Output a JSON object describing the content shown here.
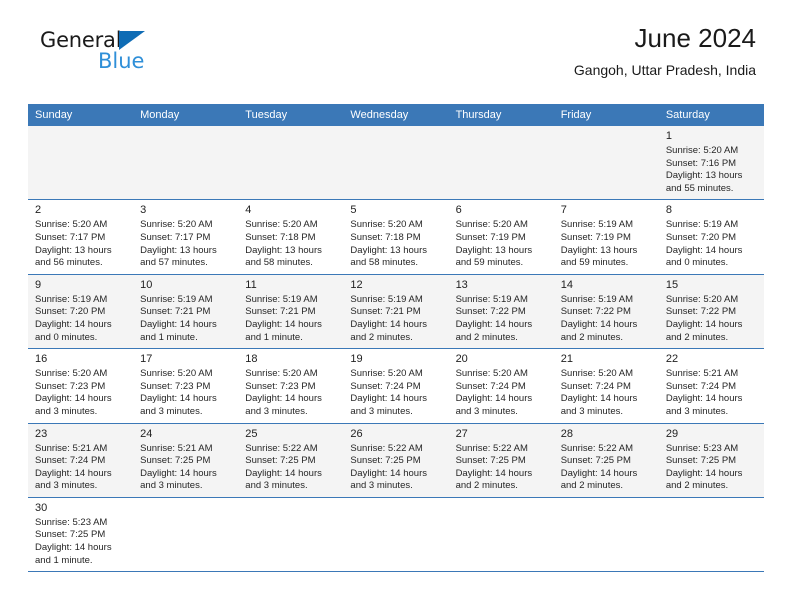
{
  "logo": {
    "word1": "General",
    "word2": "Blue",
    "triangle_color": "#0f6cb5",
    "word2_color": "#2f8fd8"
  },
  "header": {
    "title": "June 2024",
    "subtitle": "Gangoh, Uttar Pradesh, India"
  },
  "calendar": {
    "header_color": "#3b78b7",
    "weekdays": [
      "Sunday",
      "Monday",
      "Tuesday",
      "Wednesday",
      "Thursday",
      "Friday",
      "Saturday"
    ],
    "weeks": [
      [
        {
          "empty": true
        },
        {
          "empty": true
        },
        {
          "empty": true
        },
        {
          "empty": true
        },
        {
          "empty": true
        },
        {
          "empty": true
        },
        {
          "day": "1",
          "sunrise": "Sunrise: 5:20 AM",
          "sunset": "Sunset: 7:16 PM",
          "daylight1": "Daylight: 13 hours",
          "daylight2": "and 55 minutes."
        }
      ],
      [
        {
          "day": "2",
          "sunrise": "Sunrise: 5:20 AM",
          "sunset": "Sunset: 7:17 PM",
          "daylight1": "Daylight: 13 hours",
          "daylight2": "and 56 minutes."
        },
        {
          "day": "3",
          "sunrise": "Sunrise: 5:20 AM",
          "sunset": "Sunset: 7:17 PM",
          "daylight1": "Daylight: 13 hours",
          "daylight2": "and 57 minutes."
        },
        {
          "day": "4",
          "sunrise": "Sunrise: 5:20 AM",
          "sunset": "Sunset: 7:18 PM",
          "daylight1": "Daylight: 13 hours",
          "daylight2": "and 58 minutes."
        },
        {
          "day": "5",
          "sunrise": "Sunrise: 5:20 AM",
          "sunset": "Sunset: 7:18 PM",
          "daylight1": "Daylight: 13 hours",
          "daylight2": "and 58 minutes."
        },
        {
          "day": "6",
          "sunrise": "Sunrise: 5:20 AM",
          "sunset": "Sunset: 7:19 PM",
          "daylight1": "Daylight: 13 hours",
          "daylight2": "and 59 minutes."
        },
        {
          "day": "7",
          "sunrise": "Sunrise: 5:19 AM",
          "sunset": "Sunset: 7:19 PM",
          "daylight1": "Daylight: 13 hours",
          "daylight2": "and 59 minutes."
        },
        {
          "day": "8",
          "sunrise": "Sunrise: 5:19 AM",
          "sunset": "Sunset: 7:20 PM",
          "daylight1": "Daylight: 14 hours",
          "daylight2": "and 0 minutes."
        }
      ],
      [
        {
          "day": "9",
          "sunrise": "Sunrise: 5:19 AM",
          "sunset": "Sunset: 7:20 PM",
          "daylight1": "Daylight: 14 hours",
          "daylight2": "and 0 minutes."
        },
        {
          "day": "10",
          "sunrise": "Sunrise: 5:19 AM",
          "sunset": "Sunset: 7:21 PM",
          "daylight1": "Daylight: 14 hours",
          "daylight2": "and 1 minute."
        },
        {
          "day": "11",
          "sunrise": "Sunrise: 5:19 AM",
          "sunset": "Sunset: 7:21 PM",
          "daylight1": "Daylight: 14 hours",
          "daylight2": "and 1 minute."
        },
        {
          "day": "12",
          "sunrise": "Sunrise: 5:19 AM",
          "sunset": "Sunset: 7:21 PM",
          "daylight1": "Daylight: 14 hours",
          "daylight2": "and 2 minutes."
        },
        {
          "day": "13",
          "sunrise": "Sunrise: 5:19 AM",
          "sunset": "Sunset: 7:22 PM",
          "daylight1": "Daylight: 14 hours",
          "daylight2": "and 2 minutes."
        },
        {
          "day": "14",
          "sunrise": "Sunrise: 5:19 AM",
          "sunset": "Sunset: 7:22 PM",
          "daylight1": "Daylight: 14 hours",
          "daylight2": "and 2 minutes."
        },
        {
          "day": "15",
          "sunrise": "Sunrise: 5:20 AM",
          "sunset": "Sunset: 7:22 PM",
          "daylight1": "Daylight: 14 hours",
          "daylight2": "and 2 minutes."
        }
      ],
      [
        {
          "day": "16",
          "sunrise": "Sunrise: 5:20 AM",
          "sunset": "Sunset: 7:23 PM",
          "daylight1": "Daylight: 14 hours",
          "daylight2": "and 3 minutes."
        },
        {
          "day": "17",
          "sunrise": "Sunrise: 5:20 AM",
          "sunset": "Sunset: 7:23 PM",
          "daylight1": "Daylight: 14 hours",
          "daylight2": "and 3 minutes."
        },
        {
          "day": "18",
          "sunrise": "Sunrise: 5:20 AM",
          "sunset": "Sunset: 7:23 PM",
          "daylight1": "Daylight: 14 hours",
          "daylight2": "and 3 minutes."
        },
        {
          "day": "19",
          "sunrise": "Sunrise: 5:20 AM",
          "sunset": "Sunset: 7:24 PM",
          "daylight1": "Daylight: 14 hours",
          "daylight2": "and 3 minutes."
        },
        {
          "day": "20",
          "sunrise": "Sunrise: 5:20 AM",
          "sunset": "Sunset: 7:24 PM",
          "daylight1": "Daylight: 14 hours",
          "daylight2": "and 3 minutes."
        },
        {
          "day": "21",
          "sunrise": "Sunrise: 5:20 AM",
          "sunset": "Sunset: 7:24 PM",
          "daylight1": "Daylight: 14 hours",
          "daylight2": "and 3 minutes."
        },
        {
          "day": "22",
          "sunrise": "Sunrise: 5:21 AM",
          "sunset": "Sunset: 7:24 PM",
          "daylight1": "Daylight: 14 hours",
          "daylight2": "and 3 minutes."
        }
      ],
      [
        {
          "day": "23",
          "sunrise": "Sunrise: 5:21 AM",
          "sunset": "Sunset: 7:24 PM",
          "daylight1": "Daylight: 14 hours",
          "daylight2": "and 3 minutes."
        },
        {
          "day": "24",
          "sunrise": "Sunrise: 5:21 AM",
          "sunset": "Sunset: 7:25 PM",
          "daylight1": "Daylight: 14 hours",
          "daylight2": "and 3 minutes."
        },
        {
          "day": "25",
          "sunrise": "Sunrise: 5:22 AM",
          "sunset": "Sunset: 7:25 PM",
          "daylight1": "Daylight: 14 hours",
          "daylight2": "and 3 minutes."
        },
        {
          "day": "26",
          "sunrise": "Sunrise: 5:22 AM",
          "sunset": "Sunset: 7:25 PM",
          "daylight1": "Daylight: 14 hours",
          "daylight2": "and 3 minutes."
        },
        {
          "day": "27",
          "sunrise": "Sunrise: 5:22 AM",
          "sunset": "Sunset: 7:25 PM",
          "daylight1": "Daylight: 14 hours",
          "daylight2": "and 2 minutes."
        },
        {
          "day": "28",
          "sunrise": "Sunrise: 5:22 AM",
          "sunset": "Sunset: 7:25 PM",
          "daylight1": "Daylight: 14 hours",
          "daylight2": "and 2 minutes."
        },
        {
          "day": "29",
          "sunrise": "Sunrise: 5:23 AM",
          "sunset": "Sunset: 7:25 PM",
          "daylight1": "Daylight: 14 hours",
          "daylight2": "and 2 minutes."
        }
      ],
      [
        {
          "day": "30",
          "sunrise": "Sunrise: 5:23 AM",
          "sunset": "Sunset: 7:25 PM",
          "daylight1": "Daylight: 14 hours",
          "daylight2": "and 1 minute."
        },
        {
          "empty": true
        },
        {
          "empty": true
        },
        {
          "empty": true
        },
        {
          "empty": true
        },
        {
          "empty": true
        },
        {
          "empty": true
        }
      ]
    ]
  }
}
